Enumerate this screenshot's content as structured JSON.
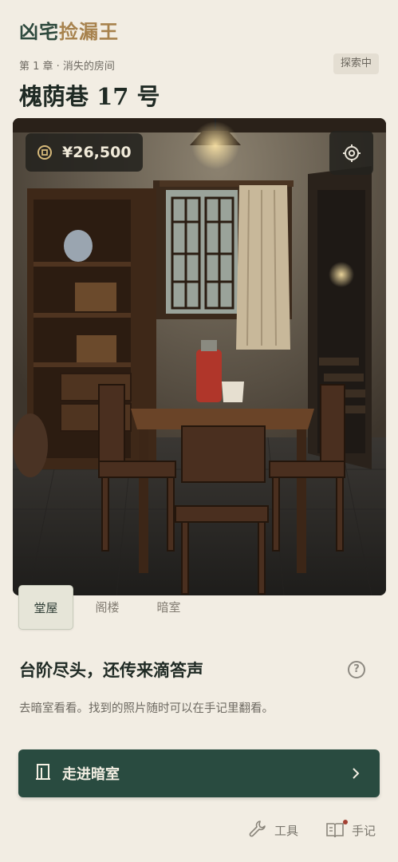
{
  "app": {
    "title_part1": "凶宅",
    "title_part2": "捡漏王"
  },
  "header": {
    "chapter": "第 1 章 · 消失的房间",
    "status": "探索中",
    "title": "槐荫巷 17 号"
  },
  "scene": {
    "money": "¥26,500",
    "money_icon": "coin-icon",
    "settings_icon": "target-gear-icon",
    "colors": {
      "wall": "#6a6358",
      "floor": "#2e2c29",
      "wood": "#4a2f1f",
      "thermos": "#b0362a"
    }
  },
  "tabs": [
    {
      "label": "堂屋",
      "active": true
    },
    {
      "label": "阁楼",
      "active": false
    },
    {
      "label": "暗室",
      "active": false
    }
  ],
  "hint": {
    "title": "台阶尽头，还传来滴答声",
    "description": "去暗室看看。找到的照片随时可以在手记里翻看。"
  },
  "primary_action": {
    "label": "走进暗室",
    "icon": "door-icon"
  },
  "bottom_nav": {
    "tools_label": "工具",
    "notes_label": "手记"
  },
  "colors": {
    "background": "#f2ede3",
    "accent": "#294b40",
    "gold": "#a7824d"
  }
}
